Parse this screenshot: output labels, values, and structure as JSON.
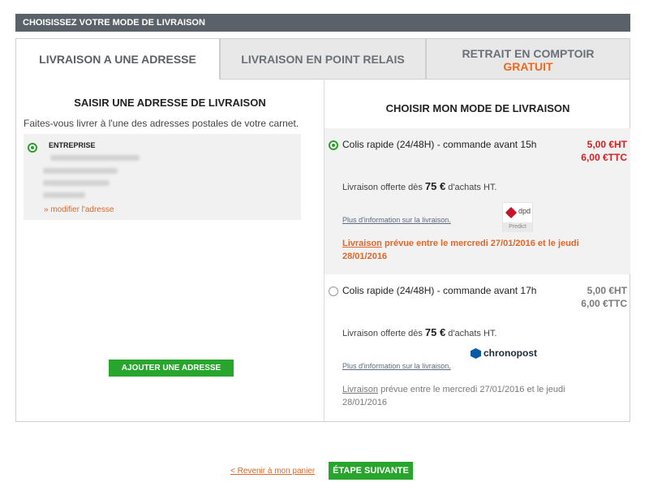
{
  "header": {
    "title": "CHOISISSEZ VOTRE MODE DE LIVRAISON"
  },
  "tabs": [
    {
      "label": "LIVRAISON A UNE ADRESSE"
    },
    {
      "label": "LIVRAISON EN POINT RELAIS"
    },
    {
      "label": "RETRAIT EN COMPTOIR",
      "sub": "GRATUIT"
    }
  ],
  "left": {
    "title": "SAISIR UNE ADRESSE DE LIVRAISON",
    "description": "Faites-vous livrer à l'une des adresses postales de votre carnet.",
    "address": {
      "name": "ENTREPRISE",
      "modify_label": "» modifier l'adresse"
    },
    "add_button": "AJOUTER UNE ADRESSE"
  },
  "right": {
    "title": "CHOISIR MON MODE DE LIVRAISON",
    "options": [
      {
        "title": "Colis rapide (24/48H) - commande avant 15h",
        "price_ht": "5,00 €HT",
        "price_ttc": "6,00 €TTC",
        "offer_prefix": "Livraison offerte dès ",
        "offer_amount": "75 €",
        "offer_suffix": " d'achats HT.",
        "info_link": "Plus d'information sur la livraison.",
        "carrier": "dpd",
        "carrier_sub": "Predict",
        "delivery_link": "Livraison",
        "delivery_text": " prévue entre le mercredi 27/01/2016 et le jeudi 28/01/2016"
      },
      {
        "title": "Colis rapide (24/48H) - commande avant 17h",
        "price_ht": "5,00 €HT",
        "price_ttc": "6,00 €TTC",
        "offer_prefix": "Livraison offerte dès ",
        "offer_amount": "75 €",
        "offer_suffix": " d'achats HT.",
        "info_link": "Plus d'information sur la livraison.",
        "carrier": "chronopost",
        "delivery_link": "Livraison",
        "delivery_text": " prévue entre le mercredi 27/01/2016 et le jeudi 28/01/2016"
      }
    ]
  },
  "footer": {
    "back_link": "< Revenir à mon panier",
    "next_button": "ÉTAPE SUIVANTE"
  },
  "colors": {
    "accent_green": "#28a52c",
    "accent_orange": "#e0662a",
    "price_red": "#d3201f",
    "header_gray": "#5b6169"
  }
}
